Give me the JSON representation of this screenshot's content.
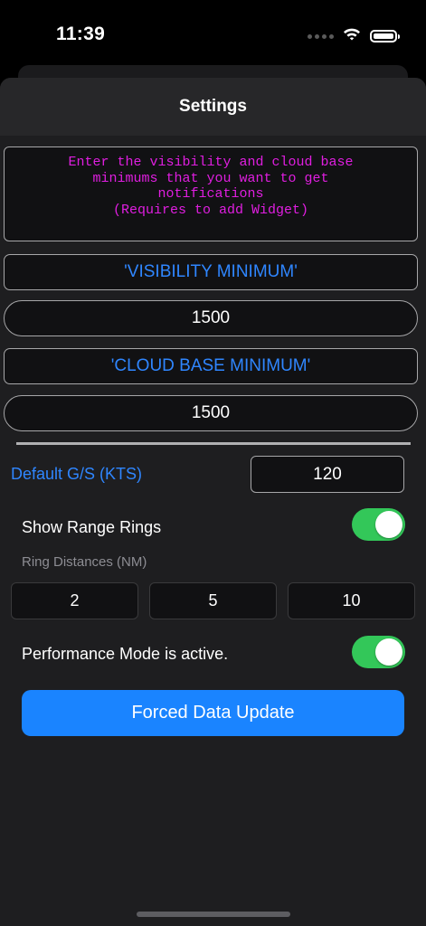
{
  "status_bar": {
    "time": "11:39"
  },
  "header": {
    "title": "Settings"
  },
  "info": {
    "lines": [
      "Enter the visibility and cloud base",
      "minimums that you want to get",
      "notifications",
      "(Requires to add Widget)"
    ]
  },
  "visibility": {
    "label": "'VISIBILITY MINIMUM'",
    "value": "1500"
  },
  "cloud_base": {
    "label": "'CLOUD BASE MINIMUM'",
    "value": "1500"
  },
  "ground_speed": {
    "label": "Default G/S (KTS)",
    "value": "120"
  },
  "range_rings": {
    "label": "Show Range Rings",
    "enabled": true,
    "distances_label": "Ring Distances (NM)",
    "distances": [
      "2",
      "5",
      "10"
    ]
  },
  "performance": {
    "label": "Performance Mode is active.",
    "enabled": true
  },
  "actions": {
    "update_label": "Forced Data Update"
  },
  "colors": {
    "accent": "#1a84ff",
    "link": "#2f86ff",
    "toggle_on": "#33c759",
    "info_text": "#e01ee0"
  }
}
